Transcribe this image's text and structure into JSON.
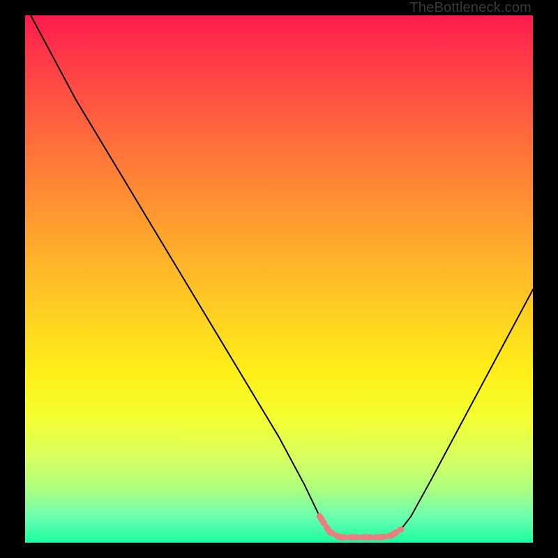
{
  "watermark": "TheBottleneck.com",
  "chart_data": {
    "type": "line",
    "title": "",
    "xlabel": "",
    "ylabel": "",
    "xlim": [
      0,
      100
    ],
    "ylim": [
      0,
      100
    ],
    "series": [
      {
        "name": "curve",
        "x": [
          0,
          10,
          20,
          30,
          40,
          50,
          55,
          58,
          60,
          61,
          62,
          65,
          70,
          72,
          74,
          76,
          80,
          90,
          100
        ],
        "values": [
          102,
          84,
          68,
          52,
          36,
          20,
          11,
          5,
          2,
          1.2,
          1,
          1,
          1,
          1.3,
          2.5,
          5,
          12,
          30,
          48
        ]
      },
      {
        "name": "highlight-band",
        "x": [
          58,
          60,
          62,
          65,
          68,
          70,
          72,
          74
        ],
        "values": [
          5,
          2,
          1,
          1,
          1,
          1,
          1.3,
          2.5
        ]
      }
    ]
  }
}
